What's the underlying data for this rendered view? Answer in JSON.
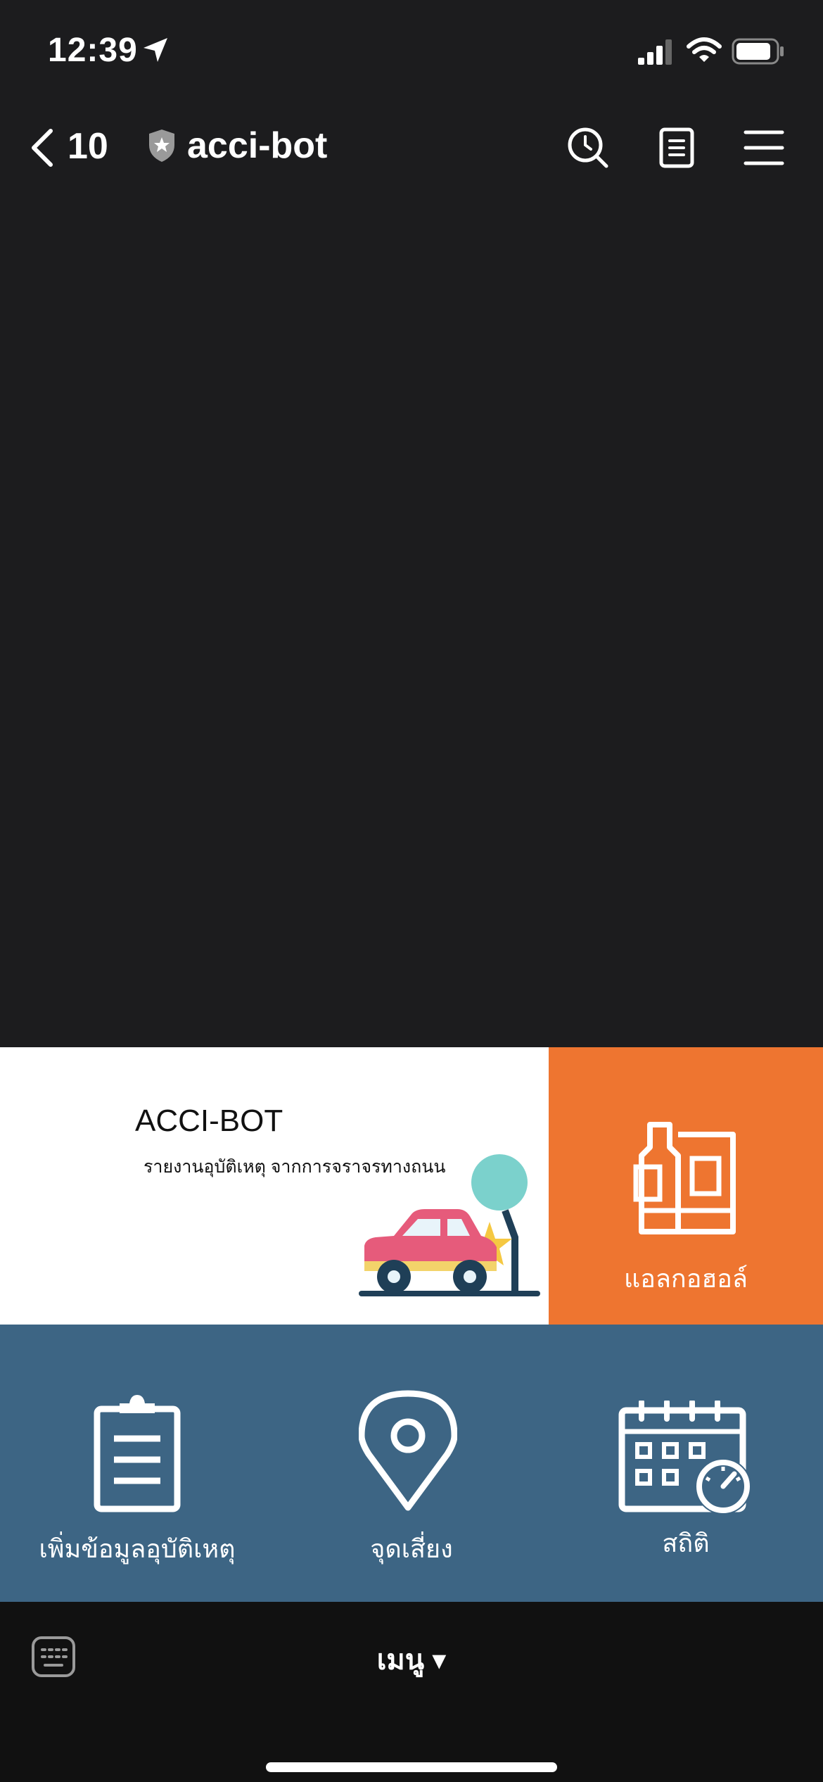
{
  "status_bar": {
    "time": "12:39"
  },
  "header": {
    "back_count": "10",
    "title": "acci-bot"
  },
  "rich_menu": {
    "banner": {
      "brand": "ACCI-BOT",
      "tagline": "รายงานอุบัติเหตุ จากการจราจรทางถนน"
    },
    "alcohol_label": "แอลกอฮอล์",
    "add_accident_label": "เพิ่มข้อมูลอุบัติเหตุ",
    "risk_point_label": "จุดเสี่ยง",
    "statistics_label": "สถิติ",
    "colors": {
      "orange": "#ee7530",
      "blue": "#3d6584"
    }
  },
  "footer": {
    "menu_label": "เมนู ▾"
  }
}
